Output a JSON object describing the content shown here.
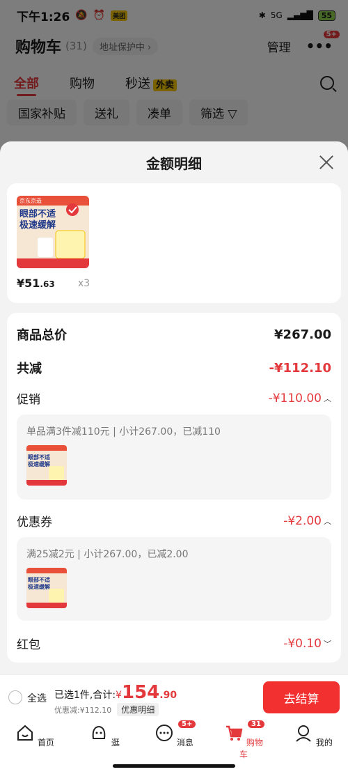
{
  "status_bar": {
    "time": "下午1:26",
    "meituan_badge": "美团",
    "network": "5G",
    "battery": "55"
  },
  "header": {
    "title": "购物车",
    "count": "(31)",
    "address_protect": "地址保护中 ›",
    "manage": "管理",
    "more_badge": "5+"
  },
  "tabs": [
    {
      "label": "全部"
    },
    {
      "label": "购物"
    },
    {
      "label": "秒送"
    }
  ],
  "tab_waimai": "外卖",
  "chips": [
    "国家补贴",
    "送礼",
    "凑单",
    "筛选 ▽"
  ],
  "sheet": {
    "title": "金额明细",
    "product": {
      "price_int": "¥51",
      "price_dec": ".63",
      "qty": "x3",
      "img_text1": "眼部不适",
      "img_text2": "极速缓解",
      "img_brand": "京东京造"
    },
    "total_label": "商品总价",
    "total_value": "¥267.00",
    "reduce_label": "共减",
    "reduce_value": "-¥112.10",
    "promo_label": "促销",
    "promo_value": "-¥110.00",
    "promo_desc": "单品满3件减110元 | 小计267.00，已减110",
    "coupon_label": "优惠券",
    "coupon_value": "-¥2.00",
    "coupon_desc": "满25减2元 | 小计267.00，已减2.00",
    "redpacket_label": "红包",
    "redpacket_value": "-¥0.10"
  },
  "checkout": {
    "select_all": "全选",
    "selected_text": "已选1件,合计:",
    "yen": "¥",
    "total_int": "154",
    "total_dec": ".90",
    "discount_text": "优惠减:¥112.10",
    "detail_label": "优惠明细",
    "button": "去结算"
  },
  "tabbar": [
    {
      "label": "首页",
      "badge": ""
    },
    {
      "label": "逛",
      "badge": ""
    },
    {
      "label": "消息",
      "badge": "5+"
    },
    {
      "label": "购物车",
      "badge": "31"
    },
    {
      "label": "我的",
      "badge": ""
    }
  ],
  "colors": {
    "accent": "#e4393c",
    "checkout_button": "#f23030",
    "waimai": "#f5c400"
  }
}
